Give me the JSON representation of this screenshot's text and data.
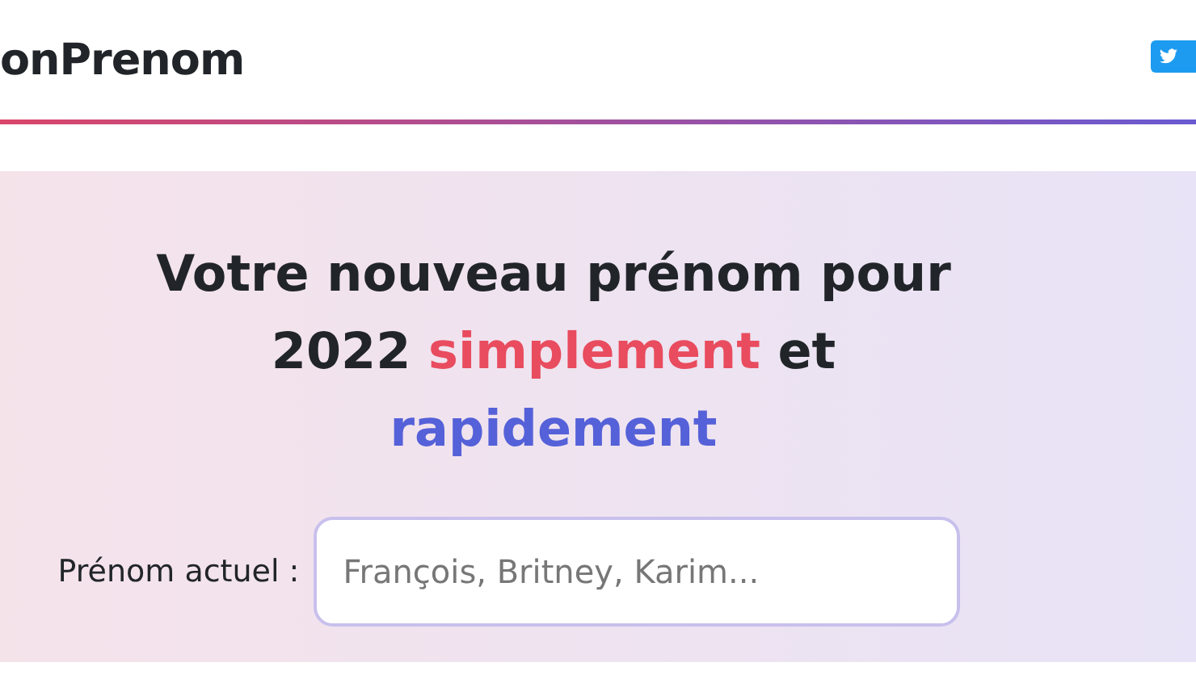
{
  "header": {
    "brand": "onPrenom"
  },
  "hero": {
    "title_parts": [
      {
        "text": "Votre nouveau prénom pour 2022 ",
        "kind": "plain"
      },
      {
        "text": "simplement",
        "kind": "red"
      },
      {
        "text": " et ",
        "kind": "plain"
      },
      {
        "text": "rapidement",
        "kind": "blue"
      }
    ],
    "field": {
      "label": "Prénom actuel :",
      "placeholder": "François, Britney, Karim..."
    }
  }
}
